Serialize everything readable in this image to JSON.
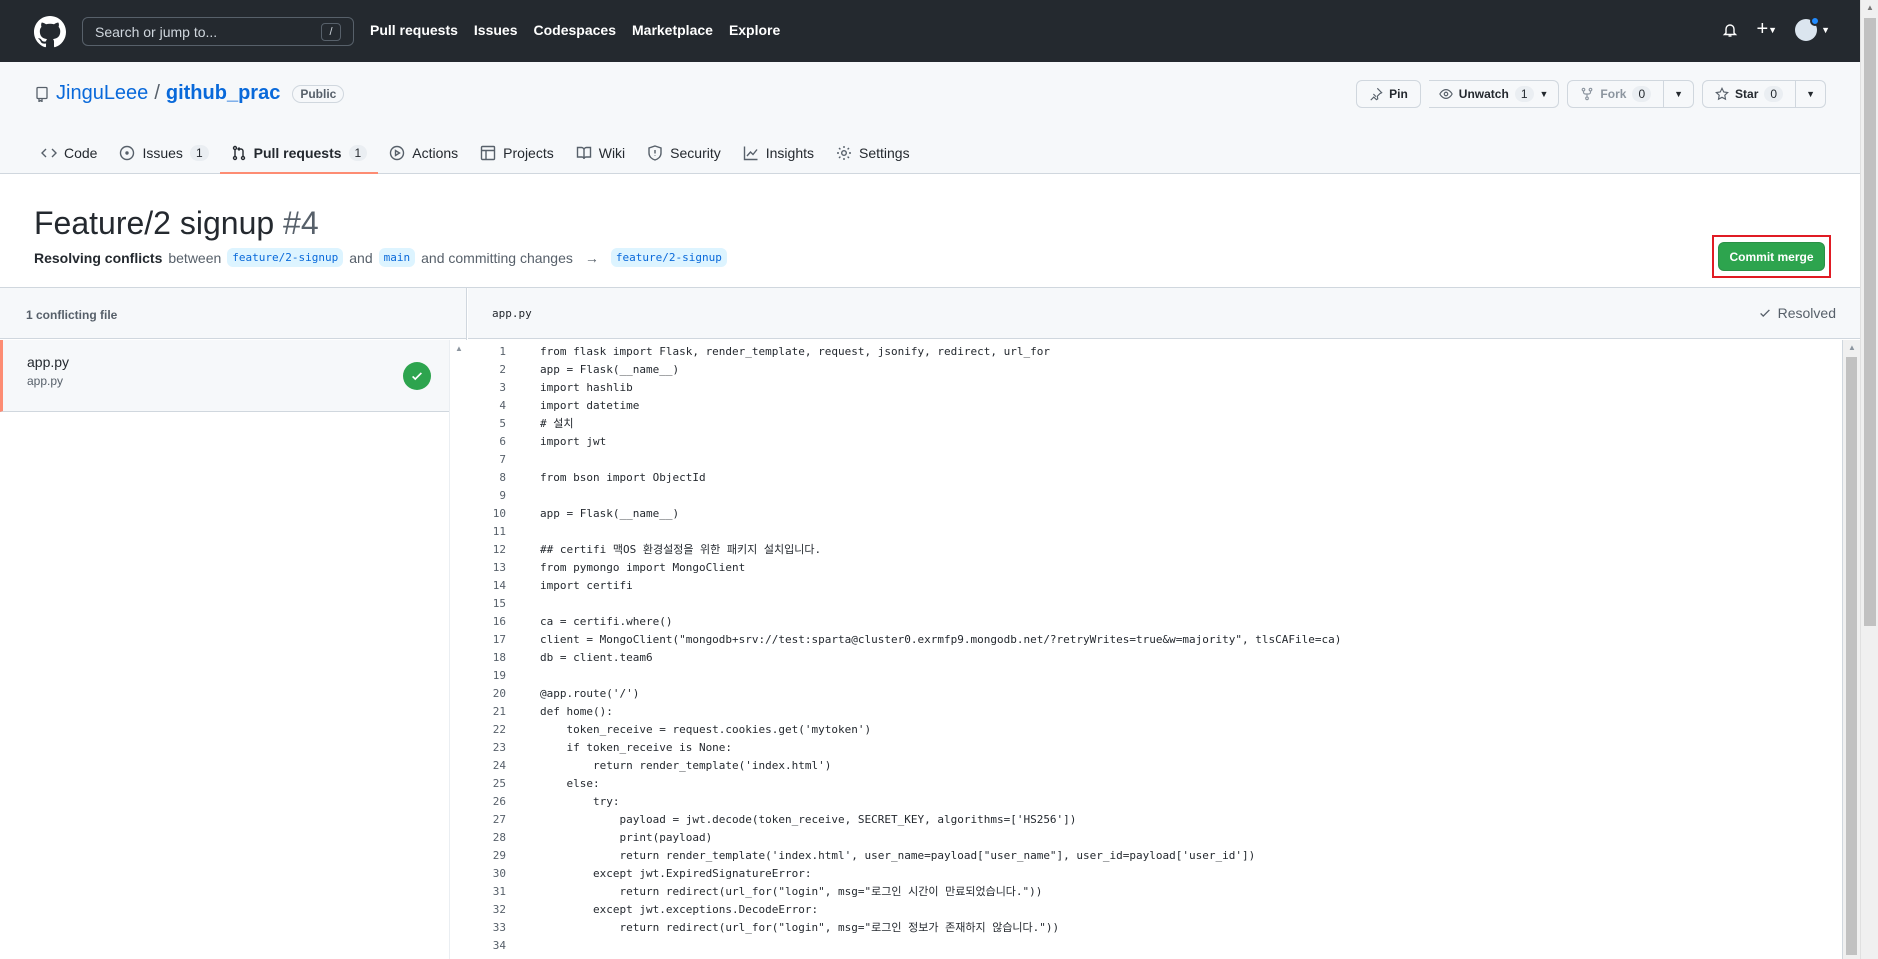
{
  "header": {
    "search_placeholder": "Search or jump to...",
    "search_shortcut": "/",
    "nav": [
      "Pull requests",
      "Issues",
      "Codespaces",
      "Marketplace",
      "Explore"
    ],
    "plus": "+"
  },
  "repo": {
    "owner": "JinguLeee",
    "separator": "/",
    "name": "github_prac",
    "visibility": "Public",
    "pin_label": "Pin",
    "unwatch_label": "Unwatch",
    "watch_count": "1",
    "fork_label": "Fork",
    "fork_count": "0",
    "star_label": "Star",
    "star_count": "0"
  },
  "tabs": [
    {
      "label": "Code",
      "icon": "code-icon",
      "count": ""
    },
    {
      "label": "Issues",
      "icon": "issue-icon",
      "count": "1"
    },
    {
      "label": "Pull requests",
      "icon": "pull-request-icon",
      "count": "1"
    },
    {
      "label": "Actions",
      "icon": "play-icon",
      "count": ""
    },
    {
      "label": "Projects",
      "icon": "table-icon",
      "count": ""
    },
    {
      "label": "Wiki",
      "icon": "book-icon",
      "count": ""
    },
    {
      "label": "Security",
      "icon": "shield-icon",
      "count": ""
    },
    {
      "label": "Insights",
      "icon": "graph-icon",
      "count": ""
    },
    {
      "label": "Settings",
      "icon": "gear-icon",
      "count": ""
    }
  ],
  "pr": {
    "title": "Feature/2 signup",
    "number": "#4",
    "resolving": "Resolving conflicts",
    "between": "between",
    "head_branch": "feature/2-signup",
    "and": "and",
    "base_branch": "main",
    "committing": "and committing changes",
    "arrow": "→",
    "target_branch": "feature/2-signup",
    "commit_label": "Commit merge"
  },
  "conflicts": {
    "count_label": "1 conflicting file",
    "file_name": "app.py",
    "file_path": "app.py",
    "editor_file": "app.py",
    "resolved_label": "Resolved"
  },
  "accent": {
    "green": "#2da44e",
    "tab_underline": "#fd8c73",
    "link": "#0969da",
    "highlight": "#e01b24"
  },
  "code_lines": [
    "from flask import Flask, render_template, request, jsonify, redirect, url_for",
    "app = Flask(__name__)",
    "import hashlib",
    "import datetime",
    "# 설치",
    "import jwt",
    "",
    "from bson import ObjectId",
    "",
    "app = Flask(__name__)",
    "",
    "## certifi 맥OS 환경설정을 위한 패키지 설치입니다.",
    "from pymongo import MongoClient",
    "import certifi",
    "",
    "ca = certifi.where()",
    "client = MongoClient(\"mongodb+srv://test:sparta@cluster0.exrmfp9.mongodb.net/?retryWrites=true&w=majority\", tlsCAFile=ca)",
    "db = client.team6",
    "",
    "@app.route('/')",
    "def home():",
    "    token_receive = request.cookies.get('mytoken')",
    "    if token_receive is None:",
    "        return render_template('index.html')",
    "    else:",
    "        try:",
    "            payload = jwt.decode(token_receive, SECRET_KEY, algorithms=['HS256'])",
    "            print(payload)",
    "            return render_template('index.html', user_name=payload[\"user_name\"], user_id=payload['user_id'])",
    "        except jwt.ExpiredSignatureError:",
    "            return redirect(url_for(\"login\", msg=\"로그인 시간이 만료되었습니다.\"))",
    "        except jwt.exceptions.DecodeError:",
    "            return redirect(url_for(\"login\", msg=\"로그인 정보가 존재하지 않습니다.\"))",
    ""
  ]
}
